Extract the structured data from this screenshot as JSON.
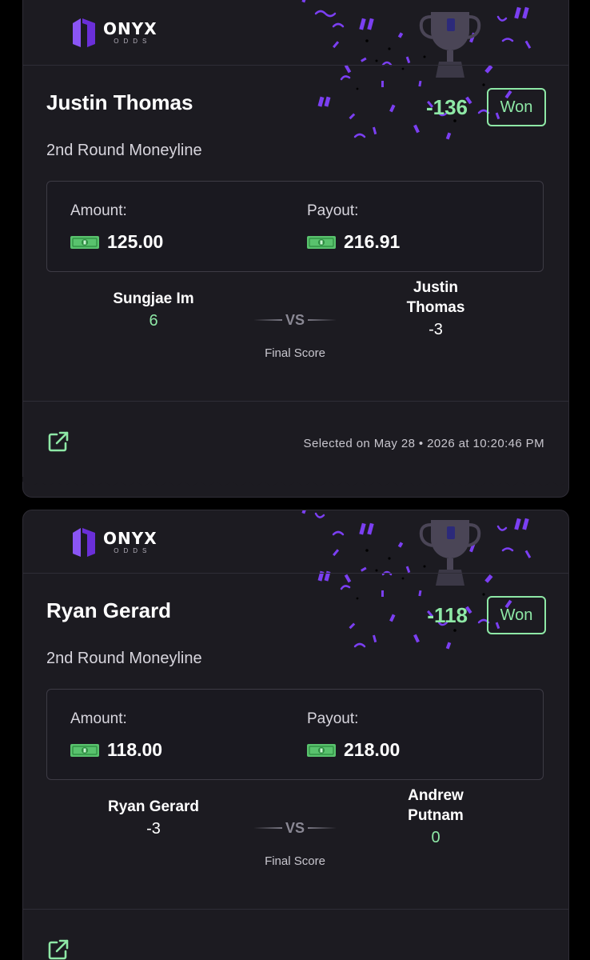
{
  "brand": {
    "name": "ONYX",
    "sub": "ODDS",
    "accent": "#7b3ff2",
    "win_color": "#8ee8a6"
  },
  "bets": [
    {
      "player": "Justin Thomas",
      "market": "2nd Round Moneyline",
      "odds": "-136",
      "status": "Won",
      "amount_label": "Amount:",
      "amount": "125.00",
      "payout_label": "Payout:",
      "payout": "216.91",
      "team_left": {
        "name": "Sungjae Im",
        "score": "6"
      },
      "vs": "VS",
      "team_right": {
        "name_line1": "Justin",
        "name_line2": "Thomas",
        "score": "-3"
      },
      "final_score_label": "Final Score",
      "selected_on": "Selected on May 28 • 2026 at 10:20:46 PM",
      "icons": [
        "trophy-icon",
        "cash-icon",
        "external-link-icon"
      ]
    },
    {
      "player": "Ryan Gerard",
      "market": "2nd Round Moneyline",
      "odds": "-118",
      "status": "Won",
      "amount_label": "Amount:",
      "amount": "118.00",
      "payout_label": "Payout:",
      "payout": "218.00",
      "team_left": {
        "name": "Ryan Gerard",
        "score": "-3"
      },
      "vs": "VS",
      "team_right": {
        "name_line1": "Andrew",
        "name_line2": "Putnam",
        "score": "0"
      },
      "final_score_label": "Final Score",
      "icons": [
        "trophy-icon",
        "cash-icon",
        "external-link-icon"
      ]
    }
  ]
}
